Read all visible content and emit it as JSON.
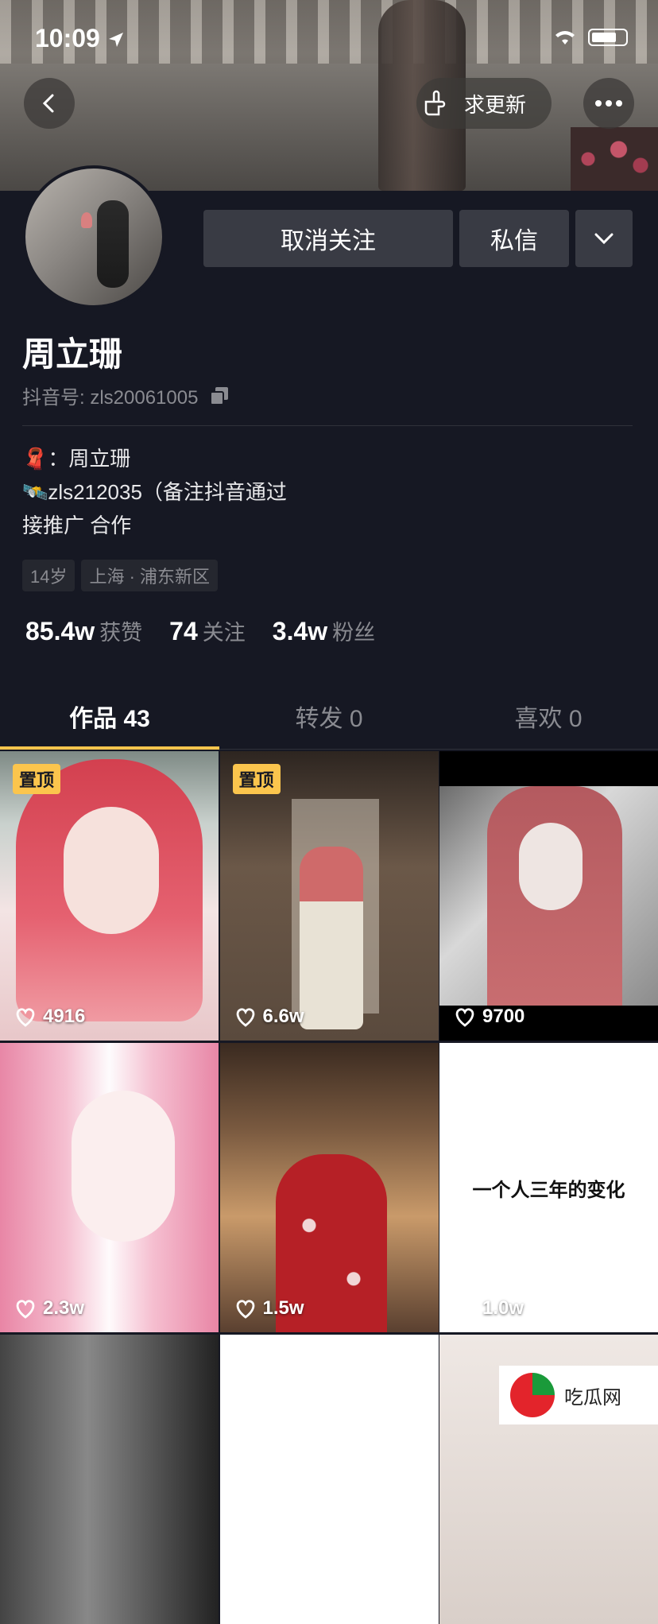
{
  "status_bar": {
    "time": "10:09"
  },
  "header": {
    "update_button_label": "求更新"
  },
  "profile": {
    "follow_button_label": "取消关注",
    "message_button_label": "私信",
    "nickname": "周立珊",
    "douyin_id": "抖音号: zls20061005",
    "bio_lines": [
      "：周立珊",
      "zls212035（备注抖音通过",
      "接推广 合作"
    ],
    "tags": [
      "14岁",
      "上海 · 浦东新区"
    ],
    "stats": [
      {
        "value": "85.4w",
        "label": "获赞"
      },
      {
        "value": "74",
        "label": "关注"
      },
      {
        "value": "3.4w",
        "label": "粉丝"
      }
    ]
  },
  "tabs": [
    {
      "label": "作品 43",
      "active": true
    },
    {
      "label": "转发 0",
      "active": false
    },
    {
      "label": "喜欢 0",
      "active": false
    }
  ],
  "videos": [
    {
      "likes": "4916",
      "pinned_label": "置顶"
    },
    {
      "likes": "6.6w",
      "pinned_label": "置顶"
    },
    {
      "likes": "9700"
    },
    {
      "likes": "2.3w"
    },
    {
      "likes": "1.5w"
    },
    {
      "likes": "1.0w",
      "caption": "一个人三年的变化"
    }
  ],
  "watermark": {
    "text": "吃瓜网"
  },
  "colors": {
    "background": "#161823",
    "accent": "#fbc54d",
    "button": "#393b44"
  }
}
